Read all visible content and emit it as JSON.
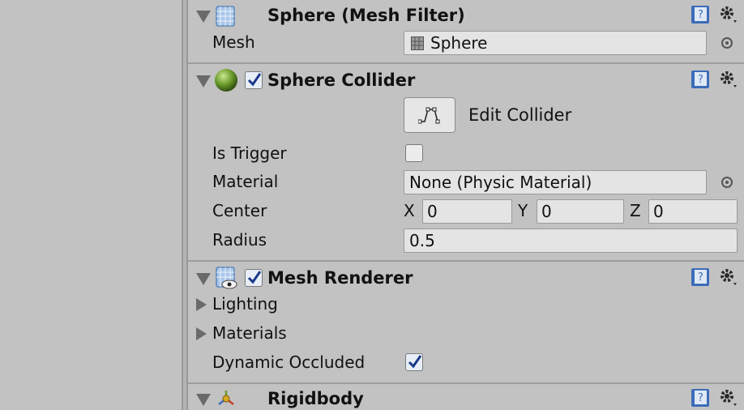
{
  "mesh_filter": {
    "title": "Sphere (Mesh Filter)",
    "mesh_label": "Mesh",
    "mesh_value": "Sphere"
  },
  "sphere_collider": {
    "title": "Sphere Collider",
    "enabled": true,
    "edit_collider_label": "Edit Collider",
    "is_trigger_label": "Is Trigger",
    "is_trigger": false,
    "material_label": "Material",
    "material_value": "None (Physic Material)",
    "center_label": "Center",
    "center": {
      "x_label": "X",
      "x": "0",
      "y_label": "Y",
      "y": "0",
      "z_label": "Z",
      "z": "0"
    },
    "radius_label": "Radius",
    "radius": "0.5"
  },
  "mesh_renderer": {
    "title": "Mesh Renderer",
    "enabled": true,
    "lighting_label": "Lighting",
    "materials_label": "Materials",
    "dynamic_occluded_label": "Dynamic Occluded",
    "dynamic_occluded": true
  },
  "rigidbody": {
    "title": "Rigidbody"
  },
  "icons": {
    "help": "help-book-icon",
    "settings": "gear-icon",
    "object_picker": "object-picker-icon",
    "collider_edit": "edit-collider-icon"
  },
  "colors": {
    "panel_bg": "#c2c2c2",
    "field_bg": "#e4e4e4",
    "checkbox_tick": "#1a3a8a",
    "help_icon": "#3d6cb8",
    "sphere_green": "#6a9a2a"
  }
}
